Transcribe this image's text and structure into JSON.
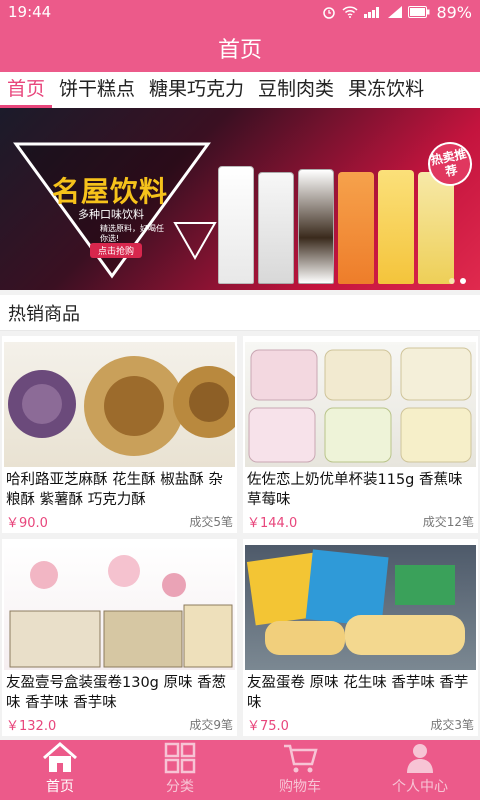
{
  "status": {
    "time": "19:44",
    "battery": "89%"
  },
  "header": {
    "title": "首页"
  },
  "tabs": [
    {
      "label": "首页"
    },
    {
      "label": "饼干糕点"
    },
    {
      "label": "糖果巧克力"
    },
    {
      "label": "豆制肉类"
    },
    {
      "label": "果冻饮料"
    }
  ],
  "banner": {
    "headline": "名屋饮料",
    "subtitle": "多种口味饮料",
    "note": "精选原料，好喝任你选!",
    "button": "点击抢购",
    "badge": "热卖推荐"
  },
  "section": {
    "title": "热销商品"
  },
  "products": [
    {
      "name": "哈利路亚芝麻酥 花生酥 椒盐酥 杂粮酥 紫薯酥 巧克力酥",
      "price": "￥90.0",
      "sold": "成交5笔"
    },
    {
      "name": "佐佐恋上奶优单杯装115g 香蕉味 草莓味",
      "price": "￥144.0",
      "sold": "成交12笔"
    },
    {
      "name": "友盈壹号盒装蛋卷130g 原味 香葱味 香芋味 香芋味",
      "price": "￥132.0",
      "sold": "成交9笔"
    },
    {
      "name": "友盈蛋卷 原味 花生味 香芋味 香芋味",
      "price": "￥75.0",
      "sold": "成交3笔"
    }
  ],
  "nav": [
    {
      "label": "首页",
      "icon": "home-icon"
    },
    {
      "label": "分类",
      "icon": "category-icon"
    },
    {
      "label": "购物车",
      "icon": "cart-icon"
    },
    {
      "label": "个人中心",
      "icon": "user-icon"
    }
  ],
  "colors": {
    "brand": "#ec5a8a",
    "price": "#e8467c"
  }
}
